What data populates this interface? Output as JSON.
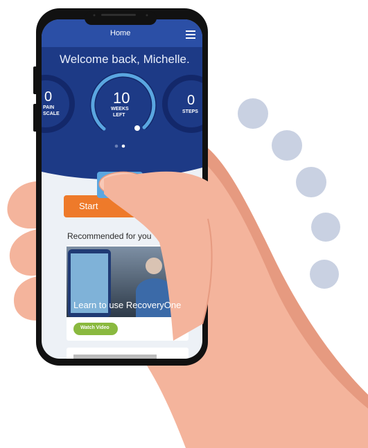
{
  "header": {
    "title": "Home",
    "menu_icon": "hamburger-menu-icon"
  },
  "welcome": {
    "text": "Welcome back, Michelle."
  },
  "gauges": [
    {
      "value": "0",
      "label_line1": "PAIN",
      "label_line2": "SCALE"
    },
    {
      "value": "10",
      "label_line1": "WEEKS",
      "label_line2": "LEFT"
    },
    {
      "value": "0",
      "label_line1": "STEPS",
      "label_line2": ""
    }
  ],
  "pager": {
    "count": 2,
    "active": 2
  },
  "start_button": {
    "label": "Start"
  },
  "recommended": {
    "heading": "Recommended for you",
    "card_title": "Learn to use RecoveryOne",
    "watch_label": "Watch Video"
  },
  "colors": {
    "header_blue": "#1d3a86",
    "gauge_arc": "#5aa6e0",
    "accent_orange": "#ee7a2a",
    "watch_green": "#8ab93f",
    "dots": "#c9d1e2",
    "skin": "#f4b49c"
  }
}
